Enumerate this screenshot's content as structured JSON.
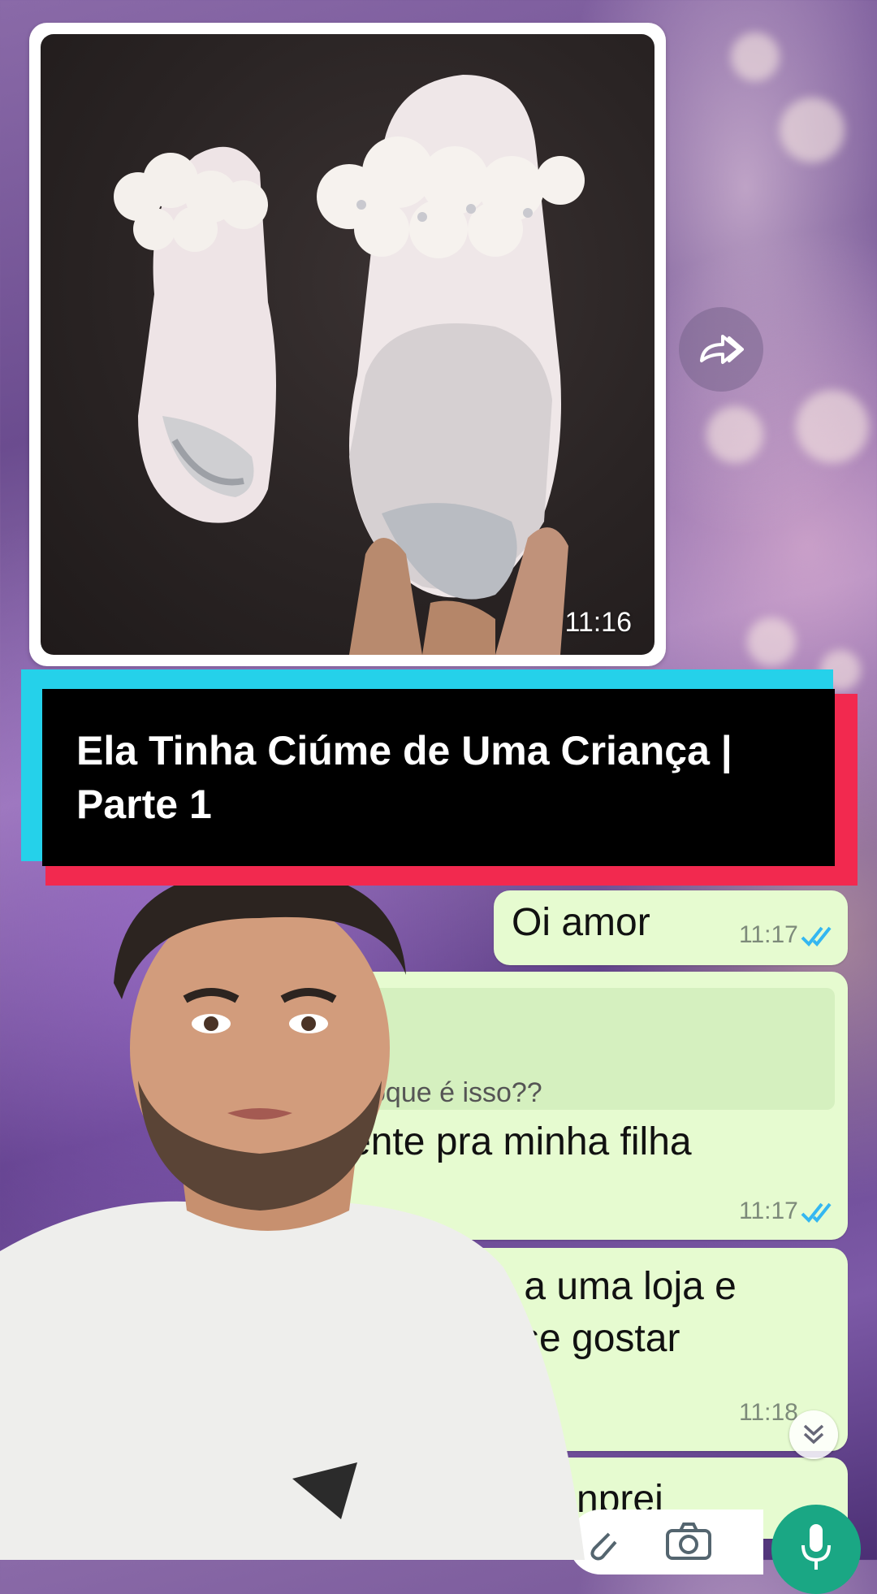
{
  "overlay": {
    "title": "Ela Tinha Ciúme de Uma Criança | Parte 1"
  },
  "image_message": {
    "time": "11:16"
  },
  "messages": [
    {
      "text": "Oi amor",
      "time": "11:17",
      "status": "read"
    },
    {
      "quote": "oque é isso??",
      "text": "ente pra minha filha",
      "time": "11:17",
      "status": "read"
    },
    {
      "lines": [
        "te a uma loja e",
        "sse gostar"
      ],
      "time": "11:18",
      "status": "read"
    },
    {
      "text": "nprei"
    }
  ],
  "colors": {
    "bubble_outgoing": "#e6fbd0",
    "tick_read": "#34b7f1",
    "banner_cyan": "#25d1ea",
    "banner_red": "#f2294f",
    "mic_button": "#1aa784"
  },
  "icons": [
    "forward-icon",
    "double-check-icon",
    "chevron-double-down-icon",
    "attach-icon",
    "camera-icon",
    "mic-icon"
  ]
}
